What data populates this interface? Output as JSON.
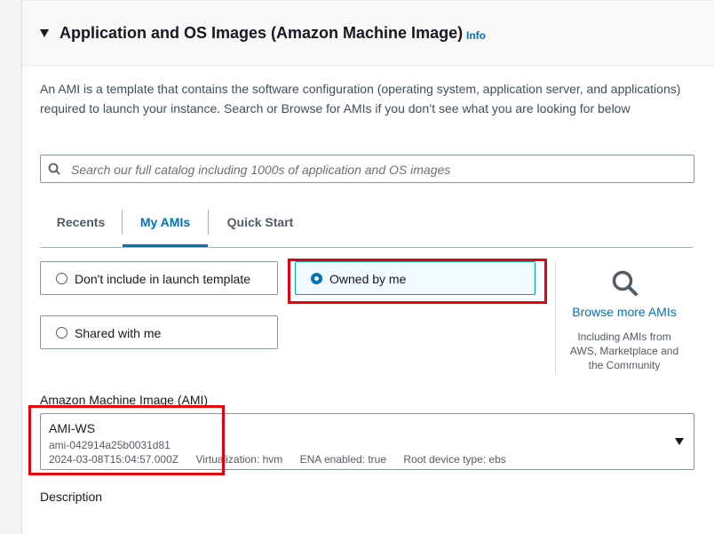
{
  "section": {
    "title": "Application and OS Images (Amazon Machine Image)",
    "info_label": "Info",
    "description": "An AMI is a template that contains the software configuration (operating system, application server, and applications) required to launch your instance. Search or Browse for AMIs if you don’t see what you are looking for below"
  },
  "search": {
    "placeholder": "Search our full catalog including 1000s of application and OS images",
    "value": ""
  },
  "tabs": [
    {
      "label": "Recents"
    },
    {
      "label": "My AMIs"
    },
    {
      "label": "Quick Start"
    }
  ],
  "active_tab": "My AMIs",
  "filters": {
    "dont_include": "Don't include in launch template",
    "owned_by_me": "Owned by me",
    "shared_with_me": "Shared with me",
    "selected": "Owned by me"
  },
  "browse": {
    "link": "Browse more AMIs",
    "subtext": "Including AMIs from AWS, Marketplace and the Community"
  },
  "ami_field": {
    "label": "Amazon Machine Image (AMI)",
    "name": "AMI-WS",
    "id": "ami-042914a25b0031d81",
    "date": "2024-03-08T15:04:57.000Z",
    "virtualization": "Virtualization: hvm",
    "ena": "ENA enabled: true",
    "root_device": "Root device type: ebs"
  },
  "description_label": "Description",
  "colors": {
    "accent": "#0073bb",
    "highlight": "#e8000b",
    "header_bg": "#f8f8f8"
  }
}
